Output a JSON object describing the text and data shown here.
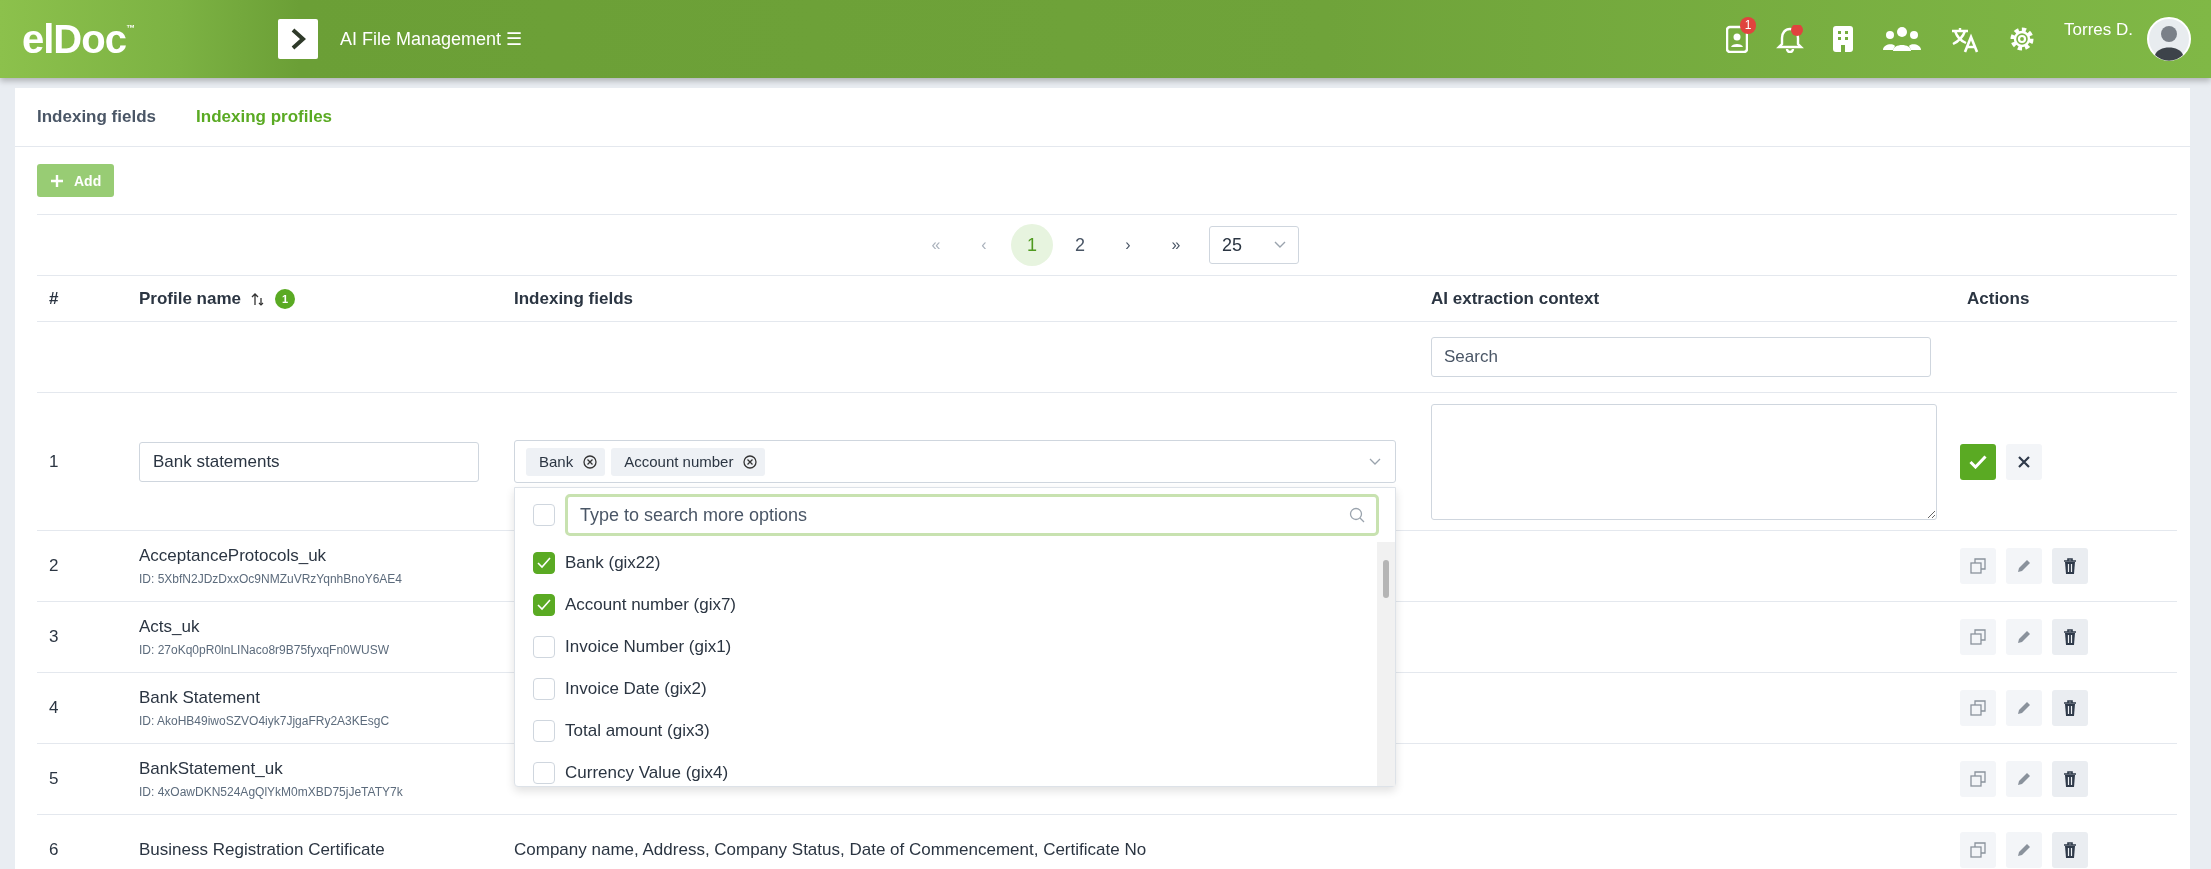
{
  "header": {
    "logo": "elDoc",
    "logo_mark": "™",
    "module": "AI File Management",
    "menu_glyph": "☰",
    "notification_badge": "1",
    "user": "Torres D."
  },
  "tabs": [
    {
      "label": "Indexing fields",
      "selected": false
    },
    {
      "label": "Indexing profiles",
      "selected": true
    }
  ],
  "add_button": "Add",
  "pagination": {
    "first": "«",
    "prev": "‹",
    "pages": [
      {
        "label": "1",
        "selected": true
      },
      {
        "label": "2",
        "selected": false
      }
    ],
    "next": "›",
    "last": "»",
    "page_size": "25"
  },
  "table": {
    "columns": [
      "#",
      "Profile name",
      "Indexing fields",
      "AI extraction context",
      "Actions"
    ],
    "sort_badge": "1",
    "search_placeholder": "Search",
    "edit_row": {
      "index": "1",
      "name": "Bank statements",
      "tags": [
        "Bank",
        "Account number"
      ]
    },
    "rows": [
      {
        "index": "2",
        "name": "AcceptanceProtocols_uk",
        "id": "ID: 5XbfN2JDzDxxOc9NMZuVRzYqnhBnoY6AE4"
      },
      {
        "index": "3",
        "name": "Acts_uk",
        "id": "ID: 27oKq0pR0lnLINaco8r9B75fyxqFn0WUSW"
      },
      {
        "index": "4",
        "name": "Bank Statement",
        "id": "ID: AkoHB49iwoSZVO4iyk7JjgaFRy2A3KEsgC"
      },
      {
        "index": "5",
        "name": "BankStatement_uk",
        "id": "ID: 4xOawDKN524AgQlYkM0mXBD75jJeTATY7k"
      },
      {
        "index": "6",
        "name": "Business Registration Certificate",
        "fields": "Company name, Address, Company Status, Date of Commencement, Certificate No"
      }
    ]
  },
  "dropdown": {
    "placeholder": "Type to search more options",
    "select_all_checked": false,
    "options": [
      {
        "label": "Bank (gix22)",
        "checked": true
      },
      {
        "label": "Account number (gix7)",
        "checked": true
      },
      {
        "label": "Invoice Number (gix1)",
        "checked": false
      },
      {
        "label": "Invoice Date (gix2)",
        "checked": false
      },
      {
        "label": "Total amount (gix3)",
        "checked": false
      },
      {
        "label": "Currency Value (gix4)",
        "checked": false
      }
    ]
  }
}
